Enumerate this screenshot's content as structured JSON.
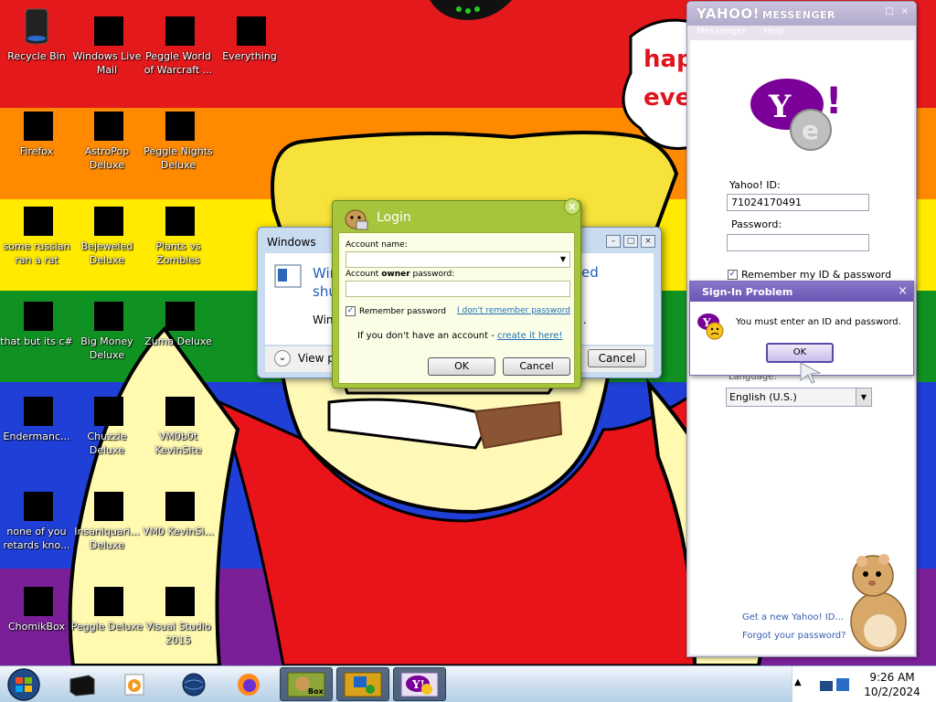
{
  "wallpaper": {
    "stripe_colors": [
      "#e81b1b",
      "#ff8c00",
      "#ffe600",
      "#0f8f20",
      "#1f3fd0",
      "#7a1f98"
    ],
    "bubble_text": "hap\neve"
  },
  "desktop_icons": [
    {
      "label": "Recycle Bin",
      "icon": "recycle-bin-icon"
    },
    {
      "label": "Windows Live Mail",
      "icon": "mail-icon"
    },
    {
      "label": "Peggle World of Warcraft ...",
      "icon": "peggle-icon"
    },
    {
      "label": "Everything",
      "icon": "search-magnifier-icon"
    },
    {
      "label": "Firefox",
      "icon": "firefox-icon"
    },
    {
      "label": "AstroPop Deluxe",
      "icon": "astropop-icon"
    },
    {
      "label": "Peggle Nights Deluxe",
      "icon": "peggle-nights-icon"
    },
    {
      "label": "some russian ran a rat",
      "icon": "ie-icon"
    },
    {
      "label": "Bejeweled Deluxe",
      "icon": "bejeweled-icon"
    },
    {
      "label": "Plants vs Zombies",
      "icon": "plants-icon"
    },
    {
      "label": "that but its c#",
      "icon": "app-icon"
    },
    {
      "label": "Big Money Deluxe",
      "icon": "money-bag-icon"
    },
    {
      "label": "Zuma Deluxe",
      "icon": "zuma-icon"
    },
    {
      "label": "Endermanc...",
      "icon": "terminal-icon"
    },
    {
      "label": "Chuzzle Deluxe",
      "icon": "chuzzle-icon"
    },
    {
      "label": "VM0b0t KevinSite",
      "icon": "vm-icon"
    },
    {
      "label": "none of you retards kno...",
      "icon": "game-icon"
    },
    {
      "label": "Insaniquari... Deluxe",
      "icon": "fish-icon"
    },
    {
      "label": "VM0 KevinSi...",
      "icon": "vm-icon"
    },
    {
      "label": "ChomikBox",
      "icon": "chomikbox-icon"
    },
    {
      "label": "Peggle Deluxe",
      "icon": "peggle-icon"
    },
    {
      "label": "Visual Studio 2015",
      "icon": "visual-studio-icon"
    }
  ],
  "windows_dialog": {
    "title": "Windows",
    "heading_line1": "Win",
    "heading_line2": "shu",
    "heading_right": "ed",
    "sub_text": "Win",
    "sub_right": ".",
    "view_text": "View p",
    "cancel_label": "Cancel"
  },
  "login": {
    "title": "Login",
    "account_name_label": "Account name:",
    "account_name_value": "",
    "password_label_pre": "Account ",
    "password_label_bold": "owner",
    "password_label_post": " password:",
    "password_value": "",
    "remember_label": "Remember password",
    "remember_checked": "✓",
    "forgot_link": "I don't remember password",
    "no_account_text": "If you don't have an account - ",
    "create_link": "create it here!",
    "ok_label": "OK",
    "cancel_label": "Cancel"
  },
  "yahoo": {
    "brand": "YAHOO!",
    "brand_suffix": "MESSENGER",
    "menu": [
      "Messenger",
      "Help"
    ],
    "id_label": "Yahoo! ID:",
    "id_value": "71024170491",
    "password_label": "Password:",
    "password_value": "",
    "remember_label": "Remember my ID & password",
    "remember_checked": "✓",
    "language_label": "Language:",
    "language_value": "English (U.S.)",
    "new_id_link": "Get a new Yahoo! ID...",
    "forgot_link": "Forgot your password?",
    "accent_color": "#7b0099"
  },
  "signin_problem": {
    "title": "Sign-In Problem",
    "message": "You must enter an ID and password.",
    "ok_label": "OK",
    "close_glyph": "×"
  },
  "taskbar": {
    "items": [
      {
        "icon": "black-window-icon",
        "active": false
      },
      {
        "icon": "media-player-icon",
        "active": false
      },
      {
        "icon": "globe-icon",
        "active": false
      },
      {
        "icon": "firefox-icon",
        "active": false
      },
      {
        "icon": "chomikbox-icon",
        "active": true
      },
      {
        "icon": "folder-app-icon",
        "active": true
      },
      {
        "icon": "yahoo-messenger-icon",
        "active": true
      }
    ],
    "time": "9:26 AM",
    "date": "10/2/2024"
  }
}
